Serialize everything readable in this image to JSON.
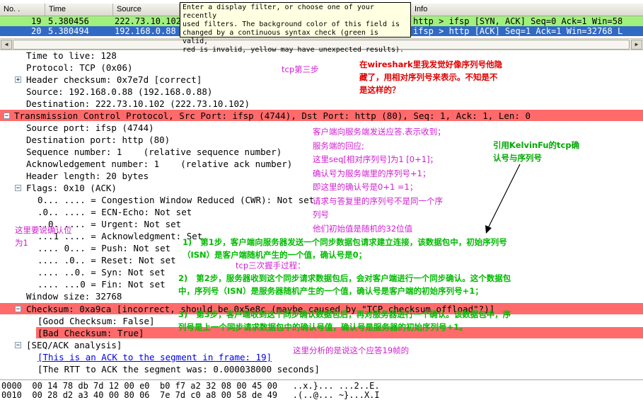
{
  "packet_list": {
    "columns": [
      "No. .",
      "Time",
      "Source",
      "Info"
    ],
    "rows": [
      {
        "no": "19",
        "time": "5.380456",
        "source": "222.73.10.102",
        "info": "http > ifsp [SYN, ACK] Seq=0 Ack=1 Win=58"
      },
      {
        "no": "20",
        "time": "5.380494",
        "source": "192.168.0.88",
        "info": "ifsp > http [ACK] Seq=1 Ack=1 Win=32768 L"
      }
    ]
  },
  "tooltip": {
    "text": "Enter a display filter, or choose one of your recently\nused filters. The background color of this field is\nchanged by a continuous syntax check (green is valid,\nred is invalid, yellow may have unexpected results)."
  },
  "details": {
    "ip_lines": [
      "Time to live: 128",
      "Protocol: TCP (0x06)",
      "Header checksum: 0x7e7d [correct]",
      "Source: 192.168.0.88 (192.168.0.88)",
      "Destination: 222.73.10.102 (222.73.10.102)"
    ],
    "tcp_header": "Transmission Control Protocol, Src Port: ifsp (4744), Dst Port: http (80), Seq: 1, Ack: 1, Len: 0",
    "tcp_lines": [
      "Source port: ifsp (4744)",
      "Destination port: http (80)",
      "Sequence number: 1    (relative sequence number)",
      "Acknowledgement number: 1    (relative ack number)",
      "Header length: 20 bytes"
    ],
    "flags_label": "Flags: 0x10 (ACK)",
    "flag_lines": [
      "0... .... = Congestion Window Reduced (CWR): Not set",
      ".0.. .... = ECN-Echo: Not set",
      "..0. .... = Urgent: Not set",
      "...1 .... = Acknowledgment: Set",
      ".... 0... = Push: Not set",
      ".... .0.. = Reset: Not set",
      ".... ..0. = Syn: Not set",
      ".... ...0 = Fin: Not set"
    ],
    "window_size": "Window size: 32768",
    "checksum_line": "Checksum: 0xa9ca [incorrect, should be 0x5e8c (maybe caused by \"TCP checksum offload\"?)]",
    "good_checksum": "[Good Checksum: False]",
    "bad_checksum": "[Bad Checksum: True]",
    "seqack_label": "[SEQ/ACK analysis]",
    "ack_link": "[This is an ACK to the segment in frame: 19]",
    "rtt_line": "[The RTT to ACK the segment was: 0.000038000 seconds]"
  },
  "annotations": {
    "tcp_step3": "tcp第三步",
    "wireshark_note": "在wireshark里我发觉好像序列号他隐\n藏了，用相对序列号来表示。不知是不\n是这样的？",
    "client_reply": "客户端向服务端发送应答.表示收到；\n服务端的回应;\n这里seq[相对序列号]为1 [0+1]；\n确认号为服务端里的序列号+1；\n即这里的确认号是0+1 =1；\n请求与答复里的序列号不是同一个序\n列号\n他们初始值是随机的32位值",
    "quote_kelvin": "引用KelvinFu的tcp确\n认号与序列号",
    "ack_position": "这里要说确认位\n为1",
    "step1": "1)   第1步，客户端向服务器发送一个同步数据包请求建立连接，该数据包中，初始序列号\n（ISN）是客户端随机产生的一个值，确认号是0；",
    "handshake": "tcp三次握手过程：",
    "step2": "2)   第2步，服务器收到这个同步请求数据包后，会对客户端进行一个同步确认。这个数据包\n中，序列号（ISN）是服务器随机产生的一个值，确认号是客户端的初始序列号+1；",
    "step3": "3)   第3步，客户端收到这个同步确认数据包后，再对服务器进行一个确认。该数据包中，序\n列号是上一个同步请求数据包中的确认号值，确认号是服务器的初始序列号+1。",
    "analysis_note": "这里分析的是说这个应答19帧的"
  },
  "hex": {
    "lines": [
      "0000  00 14 78 db 7d 12 00 e0  b0 f7 a2 32 08 00 45 00   ..x.}... ...2..E.",
      "0010  00 28 d2 a3 40 00 80 06  7e 7d c0 a8 00 58 de 49   .(..@... ~}...X.I"
    ]
  },
  "colors": {
    "green_row": "#a0f07e",
    "selected_row": "#316ac5",
    "error_band": "#ff6b6b",
    "tooltip_bg": "#ffffe1"
  }
}
